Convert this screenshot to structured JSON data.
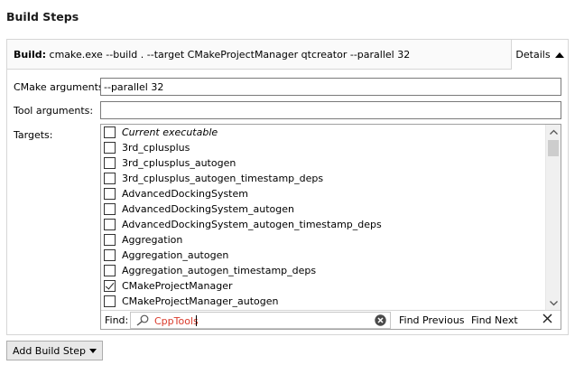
{
  "section_title": "Build Steps",
  "build": {
    "label": "Build:",
    "command": "cmake.exe --build . --target CMakeProjectManager qtcreator --parallel 32",
    "details_label": "Details"
  },
  "cmake_arguments": {
    "label": "CMake arguments:",
    "value": "--parallel 32"
  },
  "tool_arguments": {
    "label": "Tool arguments:",
    "value": ""
  },
  "targets": {
    "label": "Targets:",
    "items": [
      {
        "label": "Current executable",
        "checked": false,
        "italic": true
      },
      {
        "label": "3rd_cplusplus",
        "checked": false
      },
      {
        "label": "3rd_cplusplus_autogen",
        "checked": false
      },
      {
        "label": "3rd_cplusplus_autogen_timestamp_deps",
        "checked": false
      },
      {
        "label": "AdvancedDockingSystem",
        "checked": false
      },
      {
        "label": "AdvancedDockingSystem_autogen",
        "checked": false
      },
      {
        "label": "AdvancedDockingSystem_autogen_timestamp_deps",
        "checked": false
      },
      {
        "label": "Aggregation",
        "checked": false
      },
      {
        "label": "Aggregation_autogen",
        "checked": false
      },
      {
        "label": "Aggregation_autogen_timestamp_deps",
        "checked": false
      },
      {
        "label": "CMakeProjectManager",
        "checked": true
      },
      {
        "label": "CMakeProjectManager_autogen",
        "checked": false
      }
    ]
  },
  "find": {
    "label": "Find:",
    "value": "CppTools",
    "find_previous": "Find Previous",
    "find_next": "Find Next"
  },
  "add_build_step_label": "Add Build Step"
}
